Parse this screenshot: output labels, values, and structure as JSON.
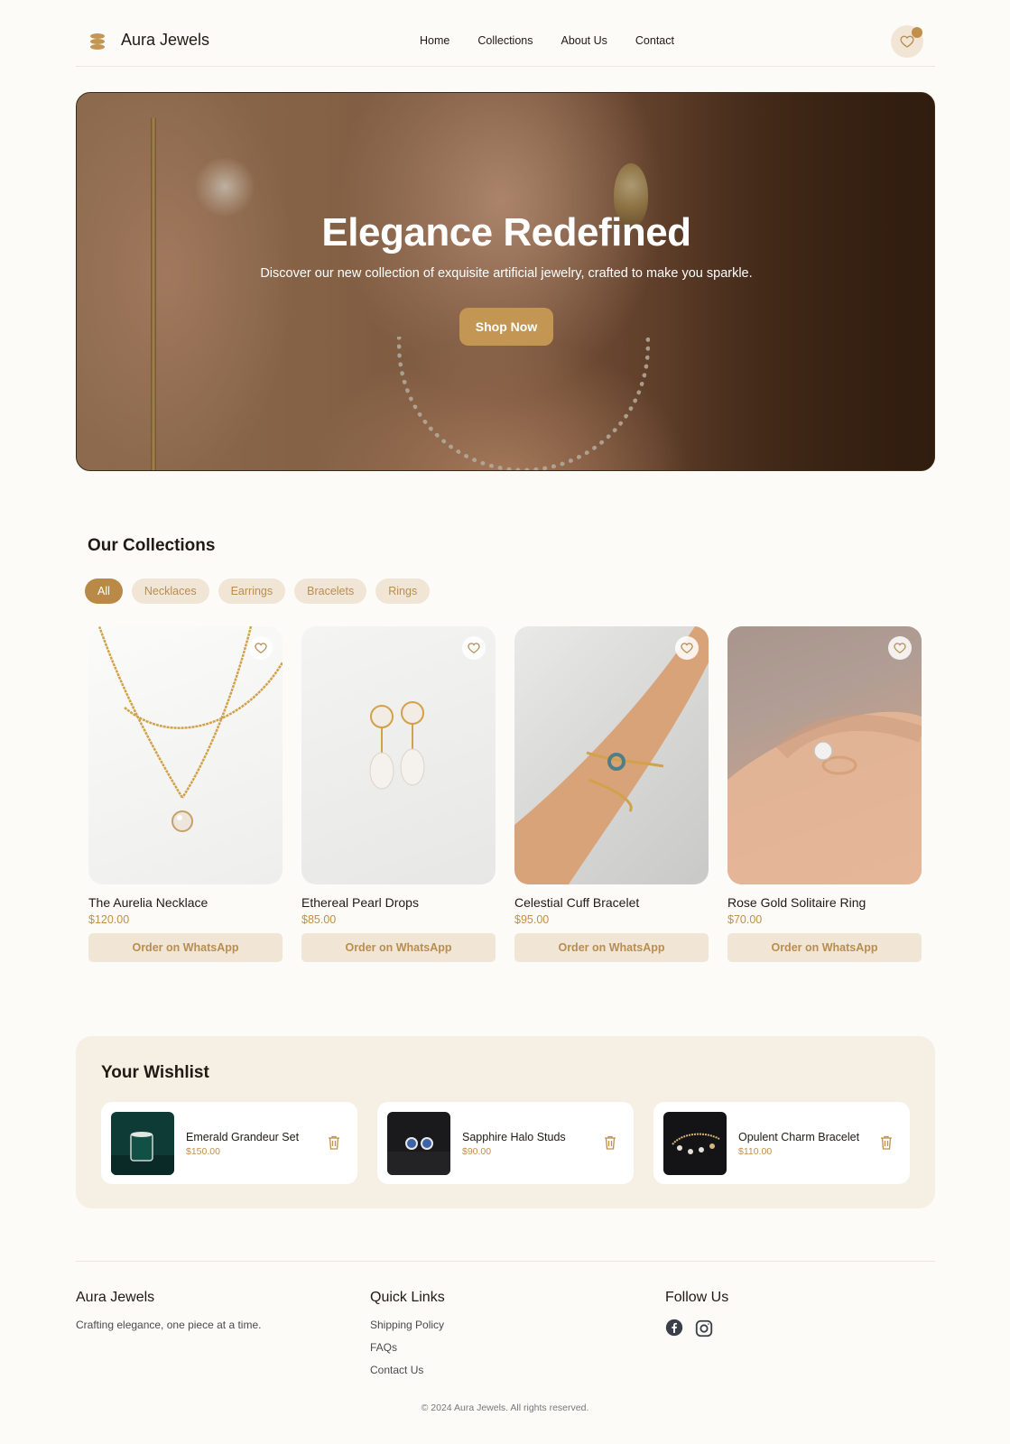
{
  "header": {
    "brand": "Aura Jewels",
    "nav": [
      "Home",
      "Collections",
      "About Us",
      "Contact"
    ],
    "logo_icon": "stacked-coins-icon",
    "wishlist_icon": "heart-icon"
  },
  "hero": {
    "title": "Elegance Redefined",
    "subtitle": "Discover our new collection of exquisite artificial jewelry, crafted to make you sparkle.",
    "cta": "Shop Now"
  },
  "collections": {
    "title": "Our Collections",
    "filters": [
      "All",
      "Necklaces",
      "Earrings",
      "Bracelets",
      "Rings"
    ],
    "active_filter": "All",
    "products": [
      {
        "name": "The Aurelia Necklace",
        "price": "$120.00",
        "cta": "Order on WhatsApp"
      },
      {
        "name": "Ethereal Pearl Drops",
        "price": "$85.00",
        "cta": "Order on WhatsApp"
      },
      {
        "name": "Celestial Cuff Bracelet",
        "price": "$95.00",
        "cta": "Order on WhatsApp"
      },
      {
        "name": "Rose Gold Solitaire Ring",
        "price": "$70.00",
        "cta": "Order on WhatsApp"
      }
    ]
  },
  "wishlist": {
    "title": "Your Wishlist",
    "items": [
      {
        "name": "Emerald Grandeur Set",
        "price": "$150.00"
      },
      {
        "name": "Sapphire Halo Studs",
        "price": "$90.00"
      },
      {
        "name": "Opulent Charm Bracelet",
        "price": "$110.00"
      }
    ]
  },
  "footer": {
    "brand": "Aura Jewels",
    "tagline": "Crafting elegance, one piece at a time.",
    "quick_links_title": "Quick Links",
    "quick_links": [
      "Shipping Policy",
      "FAQs",
      "Contact Us"
    ],
    "follow_title": "Follow Us",
    "social_icons": [
      "facebook-icon",
      "instagram-icon"
    ],
    "copyright": "© 2024 Aura Jewels. All rights reserved."
  },
  "colors": {
    "accent": "#c49653",
    "accent_light": "#f1e6d6",
    "background": "#fcfbf7",
    "text": "#1f1a14"
  }
}
